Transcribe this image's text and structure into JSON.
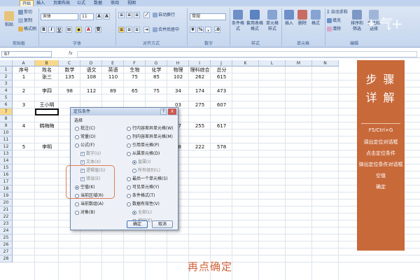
{
  "ribbon": {
    "tabs": [
      "开始",
      "插入",
      "页面布局",
      "公式",
      "数据",
      "审阅",
      "视图"
    ],
    "clipboard": {
      "paste": "粘贴",
      "cut": "剪切",
      "copy": "复制",
      "format_painter": "格式刷",
      "group": "剪贴板"
    },
    "font": {
      "name": "宋体",
      "size": "11",
      "group": "字体"
    },
    "alignment": {
      "wrap": "自动换行",
      "merge": "合并后居中",
      "group": "对齐方式"
    },
    "number": {
      "format": "常规",
      "group": "数字"
    },
    "styles": {
      "conditional": "条件格式",
      "table": "套用表格格式",
      "cell": "单元格样式",
      "group": "样式"
    },
    "cells": {
      "insert": "插入",
      "delete": "删除",
      "format": "格式",
      "group": "单元格"
    },
    "editing": {
      "autosum": "自动求和",
      "fill": "填充",
      "clear": "清除",
      "sort": "排序和筛选",
      "find": "查找和选择",
      "group": "编辑"
    }
  },
  "formula_bar": {
    "name_box": "B7",
    "fx": "fx"
  },
  "sheet": {
    "columns": [
      "A",
      "B",
      "C",
      "D",
      "E",
      "F",
      "G",
      "H",
      "I",
      "J",
      "K",
      "L",
      "M",
      "N"
    ],
    "rows": [
      "1",
      "2",
      "3",
      "4",
      "5",
      "6",
      "7",
      "8",
      "9",
      "10",
      "11",
      "12",
      "13",
      "14",
      "15",
      "16",
      "17",
      "18",
      "19",
      "20",
      "21",
      "22",
      "23",
      "24",
      "25",
      "26",
      "27",
      "28"
    ],
    "header_row": [
      "序号",
      "姓名",
      "数学",
      "语文",
      "英语",
      "生物",
      "化学",
      "物理",
      "理科综合",
      "总分"
    ],
    "records": [
      {
        "row": 2,
        "values": [
          "1",
          "张三",
          "135",
          "108",
          "110",
          "75",
          "85",
          "102",
          "262",
          "615"
        ]
      },
      {
        "row": 4,
        "values": [
          "2",
          "李四",
          "98",
          "112",
          "89",
          "65",
          "75",
          "34",
          "174",
          "473"
        ]
      },
      {
        "row": 6,
        "values": [
          "3",
          "王小明",
          "",
          "",
          "",
          "",
          "",
          "03",
          "275",
          "607"
        ]
      },
      {
        "row": 9,
        "values": [
          "4",
          "韩梅梅",
          "",
          "",
          "",
          "",
          "",
          "07",
          "255",
          "617"
        ]
      },
      {
        "row": 12,
        "values": [
          "5",
          "李明",
          "",
          "",
          "",
          "",
          "",
          "88",
          "222",
          "578"
        ]
      }
    ]
  },
  "dialog": {
    "title": "定位条件",
    "help": "?",
    "close": "X",
    "section": "选择",
    "left_options": [
      {
        "label": "批注(C)",
        "kind": "radio",
        "on": false,
        "dim": false
      },
      {
        "label": "常量(O)",
        "kind": "radio",
        "on": false,
        "dim": false
      },
      {
        "label": "公式(F)",
        "kind": "radio",
        "on": false,
        "dim": false
      },
      {
        "label": "数字(U)",
        "kind": "check",
        "on": true,
        "dim": true
      },
      {
        "label": "文本(X)",
        "kind": "check",
        "on": true,
        "dim": true
      },
      {
        "label": "逻辑值(G)",
        "kind": "check",
        "on": true,
        "dim": true
      },
      {
        "label": "错误(E)",
        "kind": "check",
        "on": true,
        "dim": true
      },
      {
        "label": "空值(K)",
        "kind": "radio",
        "on": true,
        "dim": false
      },
      {
        "label": "当前区域(R)",
        "kind": "radio",
        "on": false,
        "dim": false
      },
      {
        "label": "当前数组(A)",
        "kind": "radio",
        "on": false,
        "dim": false
      },
      {
        "label": "对象(B)",
        "kind": "radio",
        "on": false,
        "dim": false
      }
    ],
    "right_options": [
      {
        "label": "行内容差异单元格(W)",
        "kind": "radio",
        "on": false,
        "dim": false
      },
      {
        "label": "列内容差异单元格(M)",
        "kind": "radio",
        "on": false,
        "dim": false
      },
      {
        "label": "引用单元格(P)",
        "kind": "radio",
        "on": false,
        "dim": false
      },
      {
        "label": "从属单元格(D)",
        "kind": "radio",
        "on": false,
        "dim": false
      },
      {
        "label": "直属(I)",
        "kind": "radio",
        "on": true,
        "dim": true
      },
      {
        "label": "所有级别(L)",
        "kind": "radio",
        "on": false,
        "dim": true
      },
      {
        "label": "最后一个单元格(S)",
        "kind": "radio",
        "on": false,
        "dim": false
      },
      {
        "label": "可见单元格(Y)",
        "kind": "radio",
        "on": false,
        "dim": false
      },
      {
        "label": "条件格式(T)",
        "kind": "radio",
        "on": false,
        "dim": false
      },
      {
        "label": "数据有效性(V)",
        "kind": "radio",
        "on": false,
        "dim": false
      },
      {
        "label": "全部(L)",
        "kind": "radio",
        "on": true,
        "dim": true
      },
      {
        "label": "相同(E)",
        "kind": "radio",
        "on": false,
        "dim": true
      }
    ],
    "ok": "确定",
    "cancel": "取消"
  },
  "side_panel": {
    "title1": "步 骤",
    "title2": "详 解",
    "steps": [
      "F5/Ctrl+G",
      "调出定位对话框",
      "点击定位条件",
      "弹出定位条件对话框",
      "空值",
      "确定"
    ]
  },
  "caption": "再点确定",
  "colors": {
    "accent": "#c8693a",
    "caption": "#d2633a",
    "header_sel": "#f8d88a"
  }
}
